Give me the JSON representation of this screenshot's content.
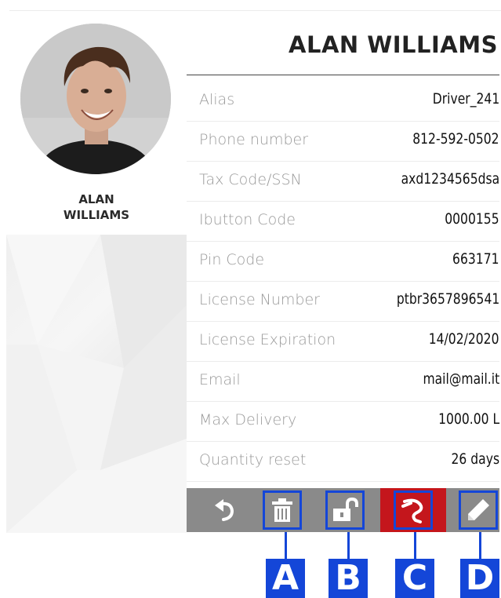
{
  "profile": {
    "first_name": "ALAN",
    "last_name": "WILLIAMS",
    "full_name": "ALAN WILLIAMS",
    "avatar": "driver-photo"
  },
  "fields": [
    {
      "label": "Alias",
      "value": "Driver_241"
    },
    {
      "label": "Phone number",
      "value": "812-592-0502"
    },
    {
      "label": "Tax Code/SSN",
      "value": "axd1234565dsa"
    },
    {
      "label": "Ibutton Code",
      "value": "0000155"
    },
    {
      "label": "Pin Code",
      "value": "663171"
    },
    {
      "label": "License Number",
      "value": "ptbr3657896541"
    },
    {
      "label": "License Expiration",
      "value": "14/02/2020"
    },
    {
      "label": "Email",
      "value": "mail@mail.it"
    },
    {
      "label": "Max Delivery",
      "value": "1000.00 L"
    },
    {
      "label": "Quantity reset",
      "value": "26 days"
    }
  ],
  "toolbar": {
    "buttons": [
      {
        "icon": "undo-icon"
      },
      {
        "icon": "trash-icon",
        "callout": "A"
      },
      {
        "icon": "unlock-icon",
        "callout": "B"
      },
      {
        "icon": "fuel-nozzle-icon",
        "callout": "C"
      },
      {
        "icon": "pencil-icon",
        "callout": "D"
      }
    ]
  },
  "colors": {
    "toolbar_bg": "#8a8a8a",
    "fuel_button_bg": "#c4161c",
    "callout_blue": "#1446d8"
  }
}
